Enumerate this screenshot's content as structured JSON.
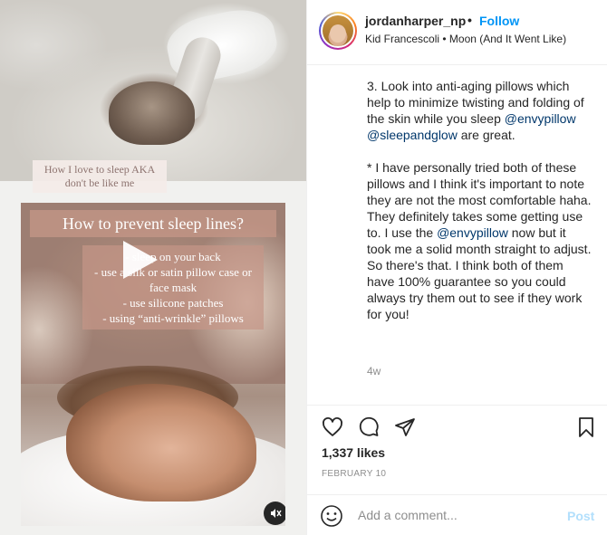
{
  "media": {
    "top_caption": "How I love to sleep AKA don't be like me",
    "video_title": "How to prevent sleep lines?",
    "video_list": [
      "- sleep on your back",
      "- use a silk or satin pillow case or face mask",
      "- use silicone patches",
      "- using “anti-wrinkle” pillows"
    ]
  },
  "header": {
    "username": "jordanharper_np",
    "separator": "•",
    "follow_label": "Follow",
    "audio": "Kid Francescoli • Moon (And It Went Like)"
  },
  "caption": {
    "p1_text": "3. Look into anti-aging pillows which help to minimize twisting and folding of the skin while you sleep ",
    "p1_mention1": "@envypillow",
    "p1_mention2": "@sleepandglow",
    "p1_tail": " are great.",
    "p2_text": "* I have personally tried both of these pillows and I think it's important to note they are not the most comfortable haha. They definitely takes some getting use to. I use the ",
    "p2_mention": "@envypillow",
    "p2_tail": " now but it took me a solid month straight to adjust. So there's that. I think both of them have 100% guarantee so you could always try them out to see if they work for you!",
    "age": "4w"
  },
  "actions": {
    "likes": "1,337 likes",
    "date": "FEBRUARY 10"
  },
  "comment_bar": {
    "placeholder": "Add a comment...",
    "post_label": "Post"
  },
  "icons": {
    "like": "heart-icon",
    "comment": "comment-icon",
    "share": "paper-plane-icon",
    "save": "bookmark-icon",
    "emoji": "smiley-icon",
    "mute": "speaker-muted-icon",
    "play": "play-icon"
  },
  "colors": {
    "follow": "#0095f6",
    "mention": "#00376b",
    "post_disabled": "#b2dffc",
    "muted_text": "#8e8e8e"
  }
}
